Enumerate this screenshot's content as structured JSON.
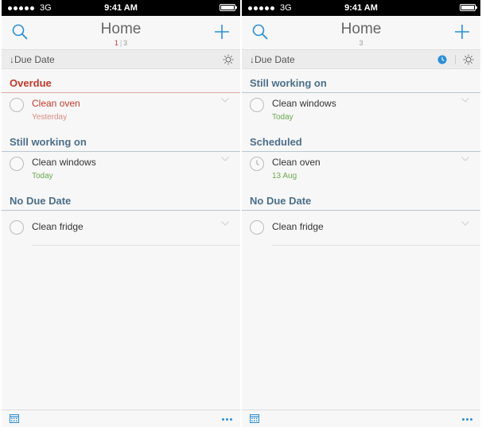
{
  "colors": {
    "accent": "#2a8fd8",
    "overdue": "#c0392b",
    "section": "#4b6f8a",
    "today": "#6aa84f"
  },
  "left": {
    "status": {
      "carrier": "3G",
      "time": "9:41 AM"
    },
    "nav": {
      "title": "Home",
      "page_active": "1",
      "page_sep": "|",
      "page_total": "3"
    },
    "sort": {
      "label": "↓Due Date"
    },
    "sections": [
      {
        "title": "Overdue",
        "tasks": [
          {
            "name": "Clean oven",
            "sub": "Yesterday"
          }
        ]
      },
      {
        "title": "Still working on",
        "tasks": [
          {
            "name": "Clean windows",
            "sub": "Today"
          }
        ]
      },
      {
        "title": "No Due Date",
        "tasks": [
          {
            "name": "Clean fridge"
          }
        ]
      }
    ]
  },
  "right": {
    "status": {
      "carrier": "3G",
      "time": "9:41 AM"
    },
    "nav": {
      "title": "Home",
      "page_total": "3"
    },
    "sort": {
      "label": "↓Due Date"
    },
    "sections": [
      {
        "title": "Still working on",
        "tasks": [
          {
            "name": "Clean windows",
            "sub": "Today"
          }
        ]
      },
      {
        "title": "Scheduled",
        "tasks": [
          {
            "name": "Clean oven",
            "sub": "13 Aug"
          }
        ]
      },
      {
        "title": "No Due Date",
        "tasks": [
          {
            "name": "Clean fridge"
          }
        ]
      }
    ]
  }
}
